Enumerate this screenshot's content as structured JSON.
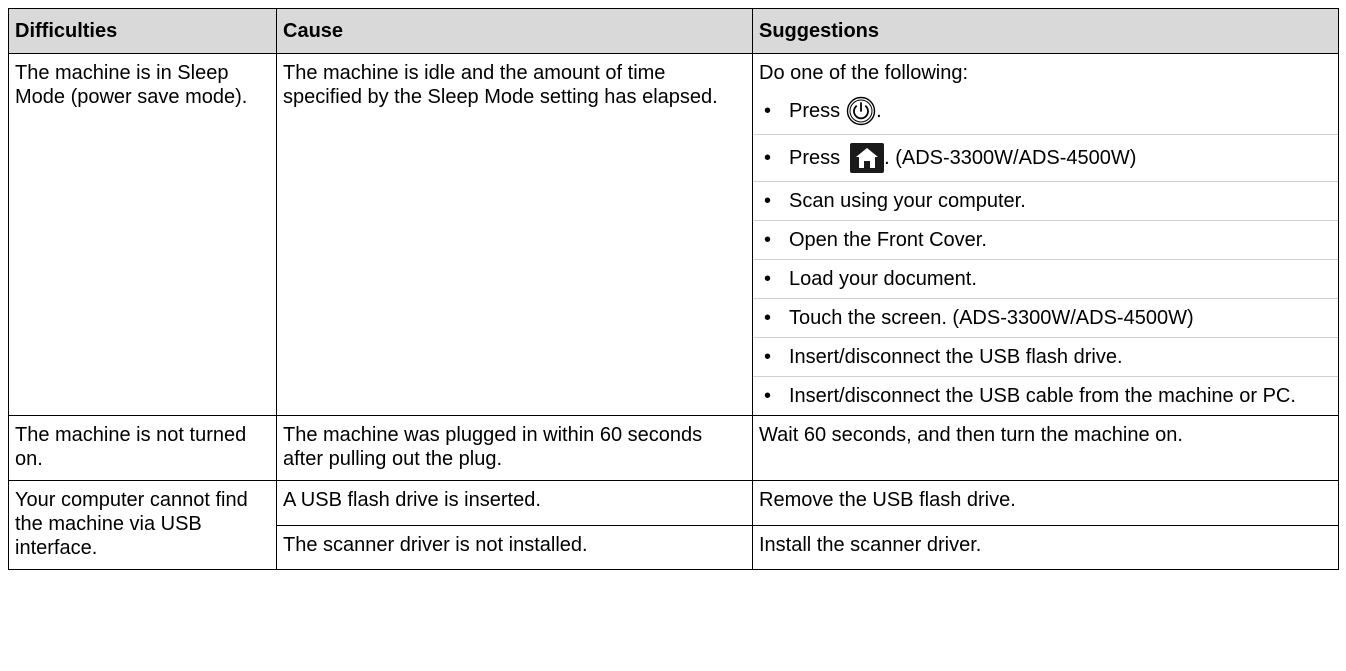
{
  "headers": {
    "difficulties": "Difficulties",
    "cause": "Cause",
    "suggestions": "Suggestions"
  },
  "rows": [
    {
      "difficulty": "The machine is in Sleep Mode (power save mode).",
      "cause": "The machine is idle and the amount of time specified by the Sleep Mode setting has elapsed.",
      "intro": "Do one of the following:",
      "items": {
        "press_power_before": "Press",
        "press_power_after": ".",
        "press_home_before": "Press",
        "press_home_after": ". (ADS-3300W/ADS-4500W)",
        "scan": "Scan using your computer.",
        "open_cover": "Open the Front Cover.",
        "load_doc": "Load your document.",
        "touch": "Touch the screen. (ADS-3300W/ADS-4500W)",
        "usb_flash": "Insert/disconnect the USB flash drive.",
        "usb_cable": "Insert/disconnect the USB cable from the machine or PC."
      }
    },
    {
      "difficulty": "The machine is not turned on.",
      "cause": "The machine was plugged in within 60 seconds after pulling out the plug.",
      "suggestion": "Wait 60 seconds, and then turn the machine on."
    },
    {
      "difficulty": "Your computer cannot find the machine via USB interface.",
      "causes": [
        {
          "cause": "A USB flash drive is inserted.",
          "suggestion": "Remove the USB flash drive."
        },
        {
          "cause": "The scanner driver is not installed.",
          "suggestion": "Install the scanner driver."
        }
      ]
    }
  ],
  "icons": {
    "power": "power-button-icon",
    "home": "home-button-icon"
  },
  "colors": {
    "header_bg": "#d9d9d9",
    "border": "#000000",
    "icon_dark": "#000000"
  }
}
